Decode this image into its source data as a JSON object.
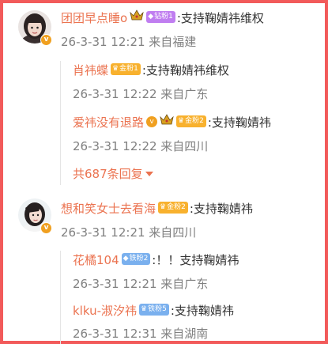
{
  "comments": [
    {
      "username": "团团早点睡o",
      "badge": "钻粉1",
      "text": ":支持鞠婧祎维权",
      "meta": "26-3-31 12:21 来自福建",
      "replies": [
        {
          "username": "肖祎蝶",
          "badge": "金粉1",
          "text": ":支持鞠婧祎维权",
          "meta": "26-3-31 12:22 来自广东"
        },
        {
          "username": "爱祎没有退路",
          "badge": "金粉2",
          "text": ":支持鞠婧祎",
          "meta": "26-3-31 12:22 来自四川"
        }
      ],
      "more_replies": "共687条回复"
    },
    {
      "username": "想和笑女士去看海",
      "badge": "金粉2",
      "text": ":支持鞠婧祎",
      "meta": "26-3-31 12:21 来自四川",
      "replies": [
        {
          "username": "花橘104",
          "badge": "铁粉2",
          "text": ":！！支持鞠婧祎",
          "meta": "26-3-31 12:21 来自广东"
        },
        {
          "username": "klku-淑汐祎",
          "badge": "铁粉5",
          "text": ":支持鞠婧祎",
          "meta": "26-3-31 12:31 来自湖南"
        }
      ]
    }
  ],
  "colors": {
    "border": "#f25a5a",
    "username": "#eb7350",
    "meta": "#808080",
    "badge_diamond": "#c07ef0",
    "badge_gold": "#f8b12e",
    "badge_iron": "#7ab0ee"
  },
  "icons": [
    "verified-v-icon",
    "crown-icon",
    "diamond-icon",
    "caret-down-icon"
  ]
}
